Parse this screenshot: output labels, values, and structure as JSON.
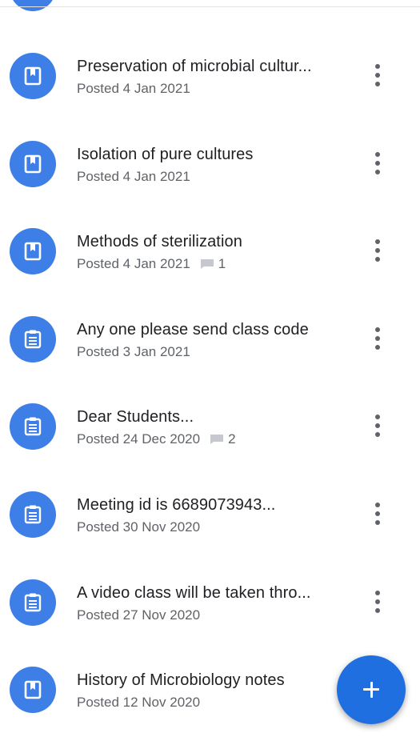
{
  "colors": {
    "avatar_blue": "#3d7fe6",
    "fab_blue": "#1f6fe0",
    "title_text": "#202124",
    "meta_text": "#5f6368"
  },
  "feed": {
    "items": [
      {
        "icon": "material-icon",
        "title": "Preservation of microbial cultur...",
        "posted": "Posted 4 Jan 2021",
        "comment_count": null
      },
      {
        "icon": "material-icon",
        "title": "Isolation of pure cultures",
        "posted": "Posted 4 Jan 2021",
        "comment_count": null
      },
      {
        "icon": "material-icon",
        "title": "Methods of sterilization",
        "posted": "Posted 4 Jan 2021",
        "comment_count": "1"
      },
      {
        "icon": "assignment-icon",
        "title": "Any one please send class code",
        "posted": "Posted 3 Jan 2021",
        "comment_count": null
      },
      {
        "icon": "assignment-icon",
        "title": "Dear Students...",
        "posted": "Posted 24 Dec 2020",
        "comment_count": "2"
      },
      {
        "icon": "assignment-icon",
        "title": "Meeting id is 6689073943...",
        "posted": "Posted 30 Nov 2020",
        "comment_count": null
      },
      {
        "icon": "assignment-icon",
        "title": "A video class will be taken thro...",
        "posted": "Posted 27 Nov 2020",
        "comment_count": null
      },
      {
        "icon": "material-icon",
        "title": "History of Microbiology notes",
        "posted": "Posted 12 Nov 2020",
        "comment_count": null
      }
    ]
  },
  "fab": {
    "icon": "plus-icon"
  }
}
